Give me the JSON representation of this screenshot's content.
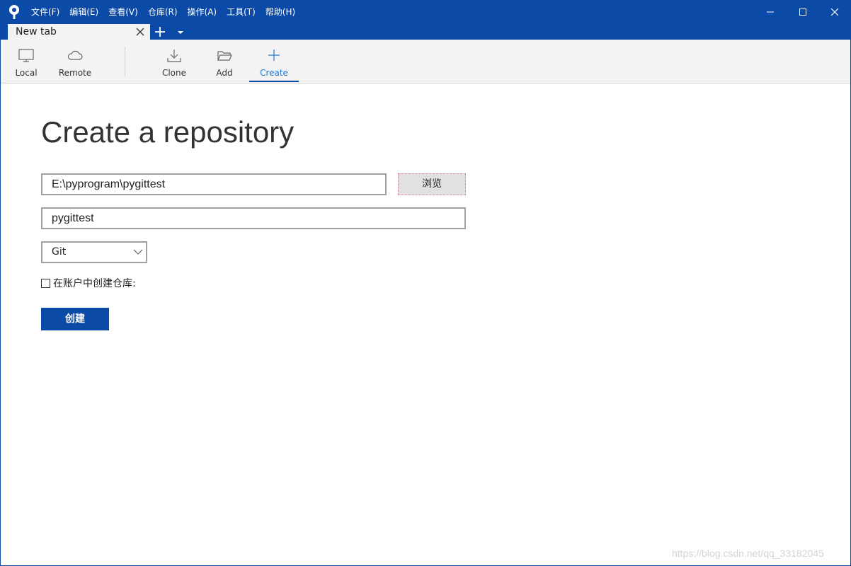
{
  "menu": {
    "items": [
      "文件(F)",
      "编辑(E)",
      "查看(V)",
      "仓库(R)",
      "操作(A)",
      "工具(T)",
      "帮助(H)"
    ]
  },
  "tabs": {
    "active_label": "New tab"
  },
  "toolbar": {
    "local_label": "Local",
    "remote_label": "Remote",
    "clone_label": "Clone",
    "add_label": "Add",
    "create_label": "Create",
    "active_tab": "Create",
    "accent_color": "#0b4aa6",
    "active_label_color": "#1e78d7"
  },
  "form": {
    "title": "Create a repository",
    "path_value": "E:\\pyprogram\\pygittest",
    "browse_label": "浏览",
    "name_value": "pygittest",
    "vcs_selected": "Git",
    "create_in_account_label": "在账户中创建仓库:",
    "create_in_account_checked": false,
    "create_button_label": "创建"
  },
  "watermark": {
    "text": "https://blog.csdn.net/qq_33182045"
  },
  "icons": {
    "app": "sourcetree-logo-icon",
    "local": "monitor-icon",
    "remote": "cloud-icon",
    "clone": "download-icon",
    "add": "folder-open-icon",
    "create": "plus-icon"
  }
}
